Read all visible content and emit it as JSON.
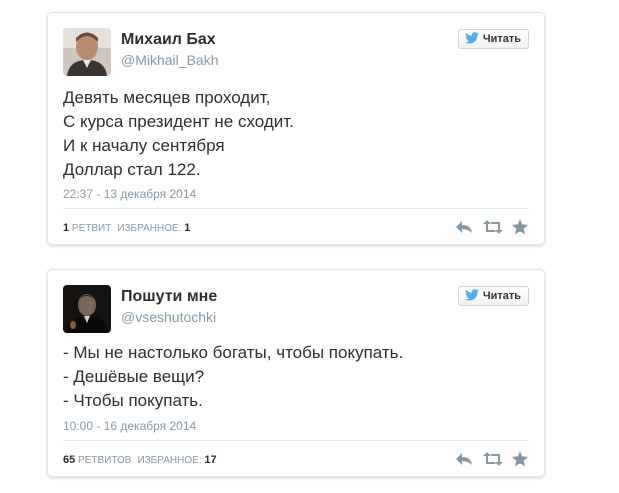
{
  "tweets": [
    {
      "author_name": "Михаил Бах",
      "author_handle": "@Mikhail_Bakh",
      "follow_label": "Читать",
      "lines": [
        "Девять месяцев проходит,",
        "С курса президент не сходит.",
        "И к началу сентября",
        "Доллар стал 122."
      ],
      "timestamp": "22:37 - 13 декабря 2014",
      "retweet_count": "1",
      "retweet_label": "РЕТВИТ",
      "favorites_label": "ИЗБРАННОЕ:",
      "favorites_count": "1"
    },
    {
      "author_name": "Пошути мне",
      "author_handle": "@vseshutochki",
      "follow_label": "Читать",
      "lines": [
        "- Мы не настолько богаты, чтобы покупать.",
        "- Дешёвые вещи?",
        "- Чтобы покупать."
      ],
      "timestamp": "10:00 - 16 декабря 2014",
      "retweet_count": "65",
      "retweet_label": "РЕТВИТОВ",
      "favorites_label": "ИЗБРАННОЕ:",
      "favorites_count": "17"
    }
  ],
  "icons": {
    "follow": "twitter-bird-icon",
    "reply": "reply-icon",
    "retweet": "retweet-icon",
    "favorite": "star-icon"
  },
  "colors": {
    "twitter_blue": "#55acee",
    "icon_gray": "#8899a6",
    "text": "#292f33"
  }
}
